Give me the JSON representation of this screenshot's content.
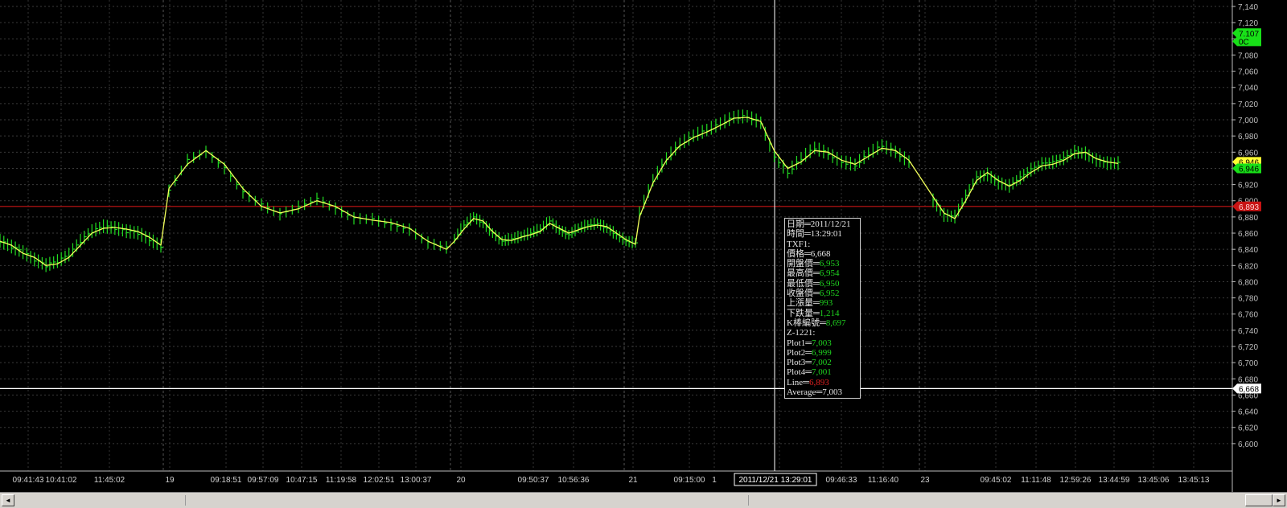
{
  "chart_data": {
    "type": "candlestick",
    "y_axis": {
      "range": [
        6584,
        7144
      ],
      "ticks": [
        "7,140",
        "7,120",
        "7,100",
        "7,080",
        "7,060",
        "7,040",
        "7,020",
        "7,000",
        "6,980",
        "6,960",
        "6,940",
        "6,920",
        "6,900",
        "6,880",
        "6,860",
        "6,840",
        "6,820",
        "6,800",
        "6,780",
        "6,760",
        "6,740",
        "6,720",
        "6,700",
        "6,680",
        "6,660",
        "6,640",
        "6,620",
        "6,600"
      ]
    },
    "x_axis": {
      "labels": [
        "09:41:43",
        "10:41:02",
        "11:45:02",
        "19",
        "09:18:51",
        "09:57:09",
        "10:47:15",
        "11:19:58",
        "12:02:51",
        "13:00:37",
        "20",
        "09:50:37",
        "10:56:36",
        "21",
        "09:15:00",
        "1",
        "13:29:01",
        "09:46:33",
        "11:16:40",
        "23",
        "09:45:02",
        "11:11:48",
        "12:59:26",
        "13:44:59",
        "13:45:06",
        "13:45:13"
      ],
      "crosshair_label": "2011/12/21 13:29:01"
    },
    "grid": true,
    "average_line": [
      [
        6850,
        6845,
        6835,
        6830,
        6820,
        6822,
        6830,
        6845,
        6860,
        6866,
        6867,
        6865,
        6862,
        6855,
        6845
      ],
      [
        6915,
        6945,
        6962,
        6945,
        6915,
        6893,
        6885,
        6890,
        6900,
        6893,
        6880,
        6876,
        6873,
        6866,
        6850,
        6840
      ],
      [
        6850,
        6865,
        6878,
        6875,
        6862,
        6852,
        6851,
        6855,
        6858,
        6862,
        6872,
        6866,
        6860,
        6864,
        6868,
        6870,
        6868,
        6860,
        6852,
        6846
      ],
      [
        6880,
        6922,
        6950,
        6968,
        6978,
        6985,
        6993,
        7002,
        7003,
        6998,
        6962,
        6940,
        6948,
        6962,
        6960,
        6950,
        6945,
        6955,
        6965,
        6962,
        6950
      ],
      [
        6905,
        6885,
        6878,
        6900,
        6925,
        6935,
        6925,
        6918,
        6925,
        6935,
        6943,
        6945,
        6950,
        6958,
        6960,
        6952,
        6948,
        6946
      ]
    ],
    "close_series": [
      [
        6850,
        6843,
        6836,
        6827,
        6820,
        6825,
        6833,
        6850,
        6862,
        6868,
        6866,
        6862,
        6860,
        6852,
        6844
      ],
      [
        6912,
        6950,
        6960,
        6940,
        6910,
        6895,
        6883,
        6892,
        6902,
        6890,
        6878,
        6877,
        6870,
        6864,
        6848,
        6842
      ],
      [
        6853,
        6870,
        6880,
        6872,
        6860,
        6850,
        6853,
        6856,
        6860,
        6865,
        6875,
        6864,
        6858,
        6866,
        6870,
        6872,
        6866,
        6858,
        6850,
        6848
      ],
      [
        6885,
        6925,
        6952,
        6970,
        6980,
        6987,
        6995,
        7003,
        7004,
        6996,
        6955,
        6935,
        6952,
        6965,
        6958,
        6948,
        6944,
        6958,
        6968,
        6960,
        6948
      ],
      [
        6900,
        6882,
        6880,
        6905,
        6928,
        6932,
        6922,
        6918,
        6928,
        6938,
        6945,
        6947,
        6952,
        6960,
        6958,
        6950,
        6946,
        6946
      ]
    ],
    "reference_lines": [
      {
        "name": "Line",
        "value": 6893,
        "color": "#c81414",
        "label": "6,893"
      },
      {
        "name": "crosshair",
        "value": 6668,
        "color": "#ffffff",
        "label": "6,668"
      }
    ],
    "price_badges": [
      {
        "value": 7107,
        "label": "7,107",
        "color": "#18e018"
      },
      {
        "value": 7097,
        "label": "0C",
        "color": "#18e018"
      },
      {
        "value": 6948,
        "label": "6,946",
        "color": "#ffff33"
      },
      {
        "value": 6940,
        "label": "6,946",
        "color": "#18e018"
      }
    ]
  },
  "tooltip": {
    "date_label": "日期═2011/12/21",
    "time_label": "時間═13:29:01",
    "symbol": "TXF1:",
    "price": {
      "label": "價格═",
      "value": "6,668"
    },
    "open": {
      "label": "開盤價═",
      "value": "6,953"
    },
    "high": {
      "label": "最高價═",
      "value": "6,954"
    },
    "low": {
      "label": "最低價═",
      "value": "6,950"
    },
    "close": {
      "label": "收盤價═",
      "value": "6,952"
    },
    "up_vol": {
      "label": "上漲量═",
      "value": "993"
    },
    "down_vol": {
      "label": "下跌量═",
      "value": "1,214"
    },
    "bar_no": {
      "label": "K棒編號═",
      "value": "8,697"
    },
    "study": "Z-1221:",
    "plot1": {
      "label": "Plot1═",
      "value": "7,003"
    },
    "plot2": {
      "label": "Plot2═",
      "value": "6,999"
    },
    "plot3": {
      "label": "Plot3═",
      "value": "7,002"
    },
    "plot4": {
      "label": "Plot4═",
      "value": "7,001"
    },
    "line": {
      "label": "Line═",
      "value": "6,893"
    },
    "average": {
      "label": "Average═",
      "value": "7,003"
    }
  },
  "scrollbar": {
    "left_arrow": "◄",
    "right_arrow": "►"
  }
}
